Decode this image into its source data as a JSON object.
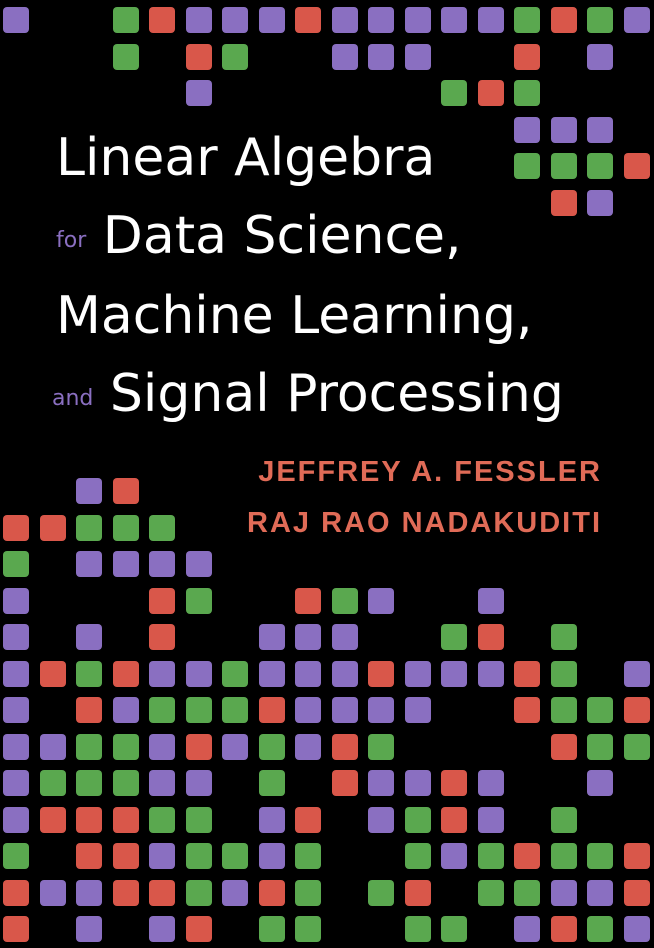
{
  "book": {
    "title_line1": "Linear Algebra",
    "for_word": "for",
    "title_line2": "Data Science,",
    "title_line3": "Machine Learning,",
    "and_word": "and",
    "title_line4": "Signal Processing",
    "authors": [
      "JEFFREY A. FESSLER",
      "RAJ RAO NADAKUDITI"
    ]
  },
  "colors": {
    "P": "#8a6fc1",
    "R": "#d9574a",
    "G": "#5aa84f",
    "text": "#ffffff",
    "accent": "#e06b57"
  },
  "pattern": {
    "top": [
      "P..GRPPPRPPPPPGRGP",
      "...G.RG..PPP..R.P.",
      ".....P......GRG...",
      "..............PPP.",
      "..............GGGR",
      "...............RP."
    ],
    "bottom": [
      "..PR..............",
      "RRGGG.............",
      "G.PPPP............",
      "P...RG..RGP..P....",
      "P.P.R..PPP..GR.G..",
      "PRGRPPGPPPRPPPRG.P",
      "P.RPGGGRPPPP..RGGR",
      "PPGGPRPGPRG....RGG",
      "PGGGPP.G.RPPRP..P.",
      "PRRRGG.PR.PGRP.G..",
      "G.RRPGGPG..GPGRGGR",
      "RPPRRGPRG.GR.GGPPR",
      "R.P.PR.GG..GG.PRGP"
    ]
  }
}
